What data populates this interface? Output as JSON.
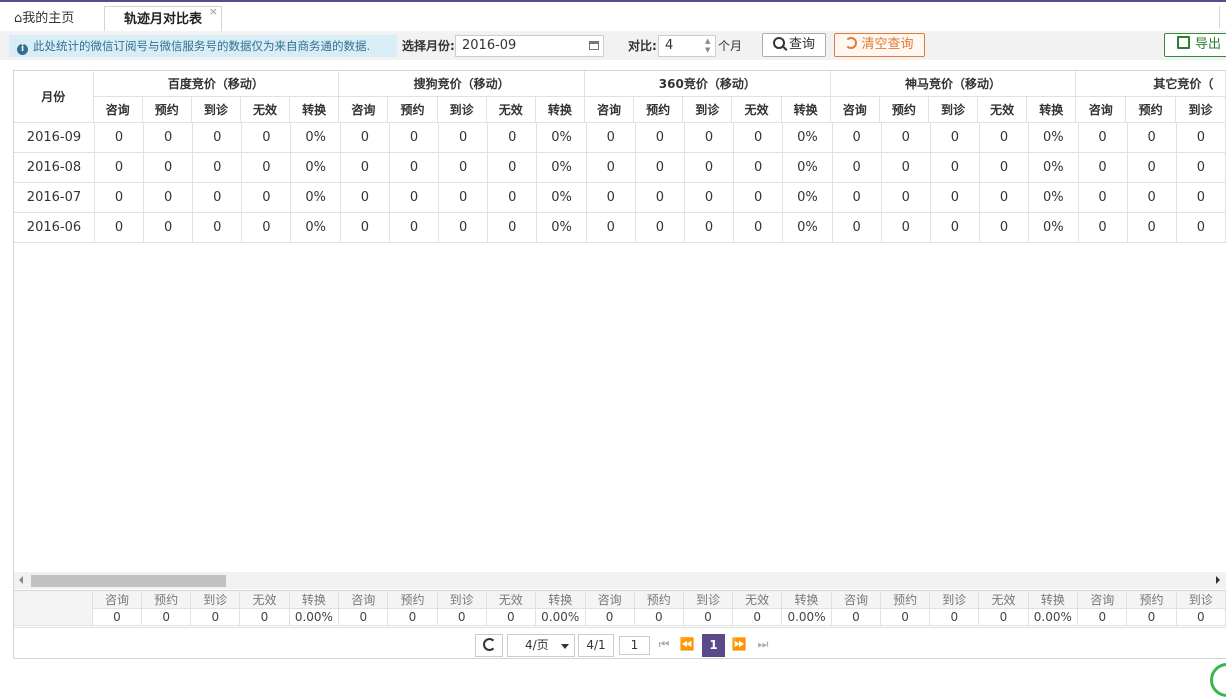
{
  "tabs": {
    "home_label": "我的主页",
    "active_label": "轨迹月对比表",
    "close_glyph": "×"
  },
  "toolbar": {
    "notice": "此处统计的微信订阅号与微信服务号的数据仅为来自商务通的数据.",
    "month_label": "选择月份:",
    "month_value": "2016-09",
    "compare_label": "对比:",
    "compare_value": "4",
    "compare_unit": "个月",
    "query_label": "查询",
    "clear_label": "清空查询",
    "export_label": "导出"
  },
  "colors": {
    "accent": "#5b4a8a",
    "notice_bg": "#d9edf7",
    "clear_button": "#e07b39",
    "export_button": "#2e7d32"
  },
  "table": {
    "month_header": "月份",
    "groups": [
      "百度竞价（移动）",
      "搜狗竞价（移动）",
      "360竞价（移动）",
      "神马竞价（移动）",
      "其它竞价（"
    ],
    "subcols": [
      "咨询",
      "预约",
      "到诊",
      "无效",
      "转换"
    ],
    "last_group_subcols": [
      "咨询",
      "预约",
      "到诊"
    ],
    "rows": [
      {
        "month": "2016-09",
        "cells": [
          "0",
          "0",
          "0",
          "0",
          "0%",
          "0",
          "0",
          "0",
          "0",
          "0%",
          "0",
          "0",
          "0",
          "0",
          "0%",
          "0",
          "0",
          "0",
          "0",
          "0%",
          "0",
          "0",
          "0"
        ]
      },
      {
        "month": "2016-08",
        "cells": [
          "0",
          "0",
          "0",
          "0",
          "0%",
          "0",
          "0",
          "0",
          "0",
          "0%",
          "0",
          "0",
          "0",
          "0",
          "0%",
          "0",
          "0",
          "0",
          "0",
          "0%",
          "0",
          "0",
          "0"
        ]
      },
      {
        "month": "2016-07",
        "cells": [
          "0",
          "0",
          "0",
          "0",
          "0%",
          "0",
          "0",
          "0",
          "0",
          "0%",
          "0",
          "0",
          "0",
          "0",
          "0%",
          "0",
          "0",
          "0",
          "0",
          "0%",
          "0",
          "0",
          "0"
        ]
      },
      {
        "month": "2016-06",
        "cells": [
          "0",
          "0",
          "0",
          "0",
          "0%",
          "0",
          "0",
          "0",
          "0",
          "0%",
          "0",
          "0",
          "0",
          "0",
          "0%",
          "0",
          "0",
          "0",
          "0",
          "0%",
          "0",
          "0",
          "0"
        ]
      }
    ],
    "footer_labels": [
      "咨询",
      "预约",
      "到诊",
      "无效",
      "转换",
      "咨询",
      "预约",
      "到诊",
      "无效",
      "转换",
      "咨询",
      "预约",
      "到诊",
      "无效",
      "转换",
      "咨询",
      "预约",
      "到诊",
      "无效",
      "转换",
      "咨询",
      "预约",
      "到诊"
    ],
    "footer_values": [
      "0",
      "0",
      "0",
      "0",
      "0.00%",
      "0",
      "0",
      "0",
      "0",
      "0.00%",
      "0",
      "0",
      "0",
      "0",
      "0.00%",
      "0",
      "0",
      "0",
      "0",
      "0.00%",
      "0",
      "0",
      "0"
    ]
  },
  "pager": {
    "page_size": "4/页",
    "page_info": "4/1",
    "jump_value": "1",
    "current_page": "1",
    "first_glyph": "⏮",
    "prev_glyph": "⏪",
    "next_glyph": "⏩",
    "last_glyph": "⏭"
  },
  "icons": {
    "home": "home-icon",
    "info": "info-icon",
    "calendar": "calendar-icon",
    "search": "search-icon",
    "undo": "undo-icon",
    "export": "sign-out-icon",
    "refresh": "refresh-icon"
  }
}
